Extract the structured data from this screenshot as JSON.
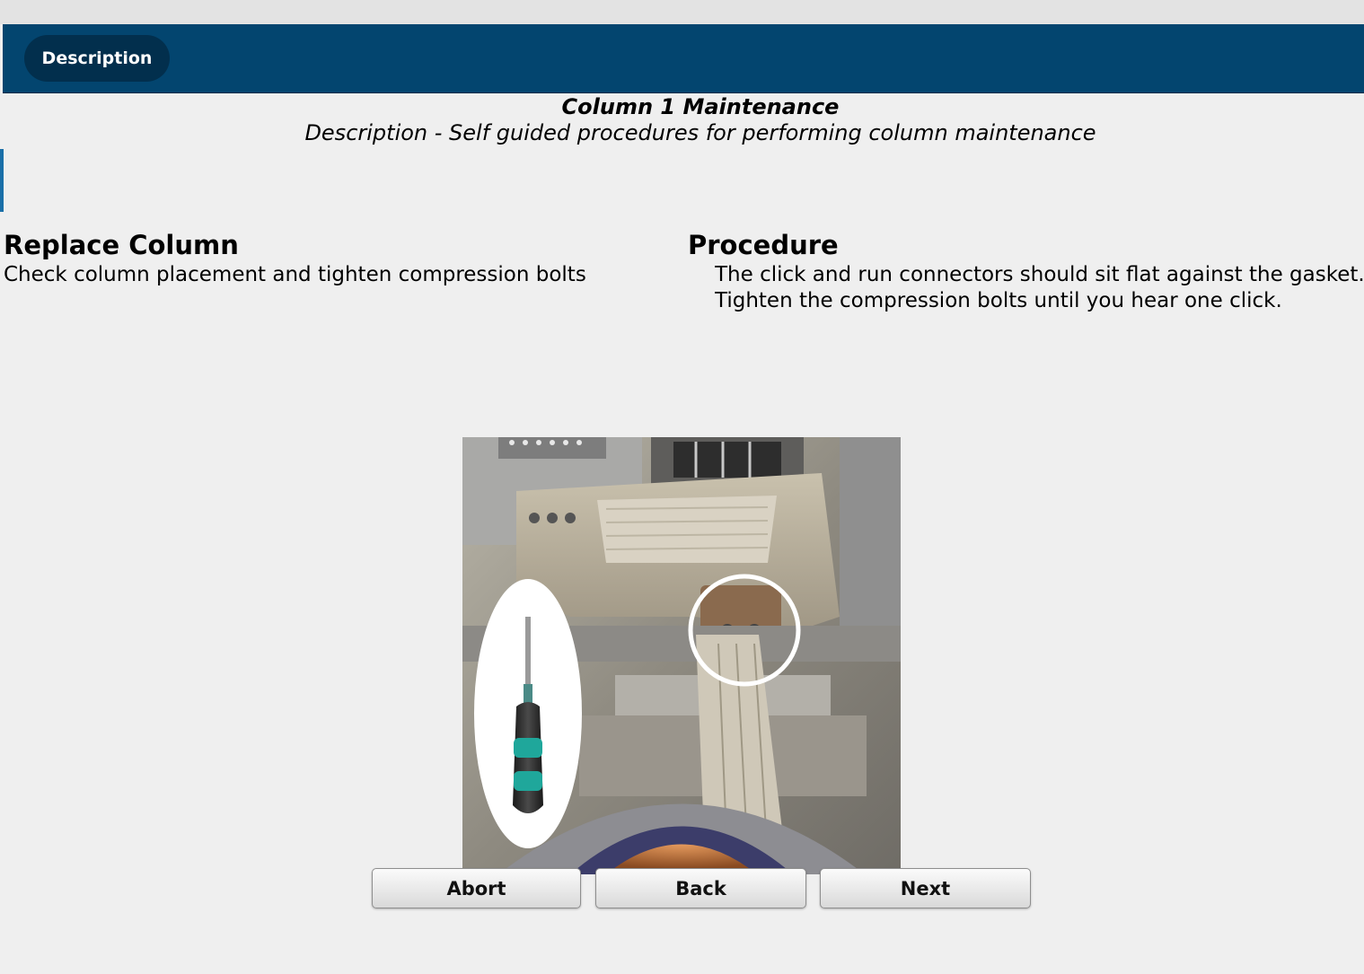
{
  "header": {
    "tab_label": "Description"
  },
  "page": {
    "title": "Column 1 Maintenance",
    "subtitle": "Description - Self guided procedures for performing column maintenance"
  },
  "left": {
    "heading": "Replace Column",
    "text": "Check column placement and tighten compression bolts"
  },
  "procedure": {
    "heading": "Procedure",
    "lines": [
      "The click and run connectors should sit flat against the gasket.",
      "Tighten the compression bolts until you hear one click."
    ]
  },
  "photo": {
    "icon": "screwdriver-icon"
  },
  "buttons": {
    "abort": "Abort",
    "back": "Back",
    "next": "Next"
  },
  "colors": {
    "header": "#03456f",
    "tab": "#022f4d",
    "background": "#efefef"
  }
}
